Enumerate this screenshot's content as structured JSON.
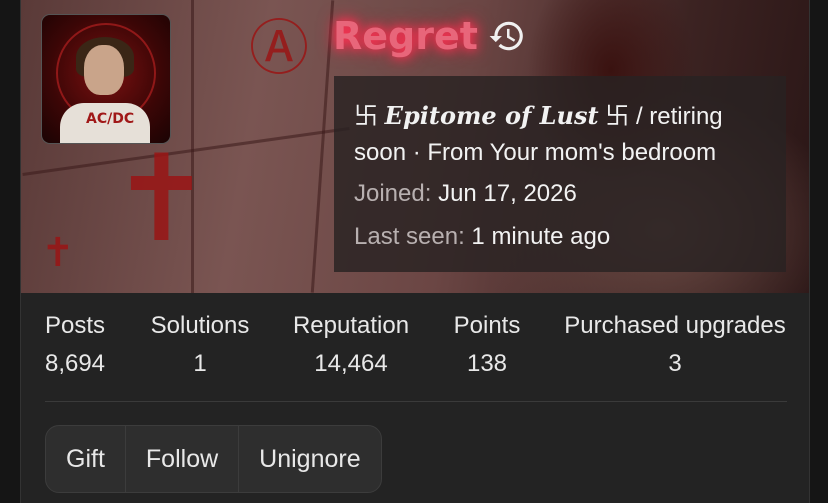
{
  "profile": {
    "username": "Regret",
    "custom_title": {
      "prefix_glyph": "卐",
      "styled_text": "Epitome of Lust",
      "suffix_glyph": "卐",
      "plain_text": "/ retiring soon · From Your mom's bedroom"
    },
    "joined_label": "Joined:",
    "joined_value": "Jun 17, 2026",
    "last_seen_label": "Last seen:",
    "last_seen_value": "1 minute ago",
    "avatar_text": "AC/DC",
    "username_color": "#e8667a"
  },
  "stats": [
    {
      "label": "Posts",
      "value": "8,694"
    },
    {
      "label": "Solutions",
      "value": "1"
    },
    {
      "label": "Reputation",
      "value": "14,464"
    },
    {
      "label": "Points",
      "value": "138"
    },
    {
      "label": "Purchased upgrades",
      "value": "3"
    }
  ],
  "actions": {
    "gift": "Gift",
    "follow": "Follow",
    "unignore": "Unignore"
  },
  "icons": {
    "username_history": "history-icon"
  }
}
